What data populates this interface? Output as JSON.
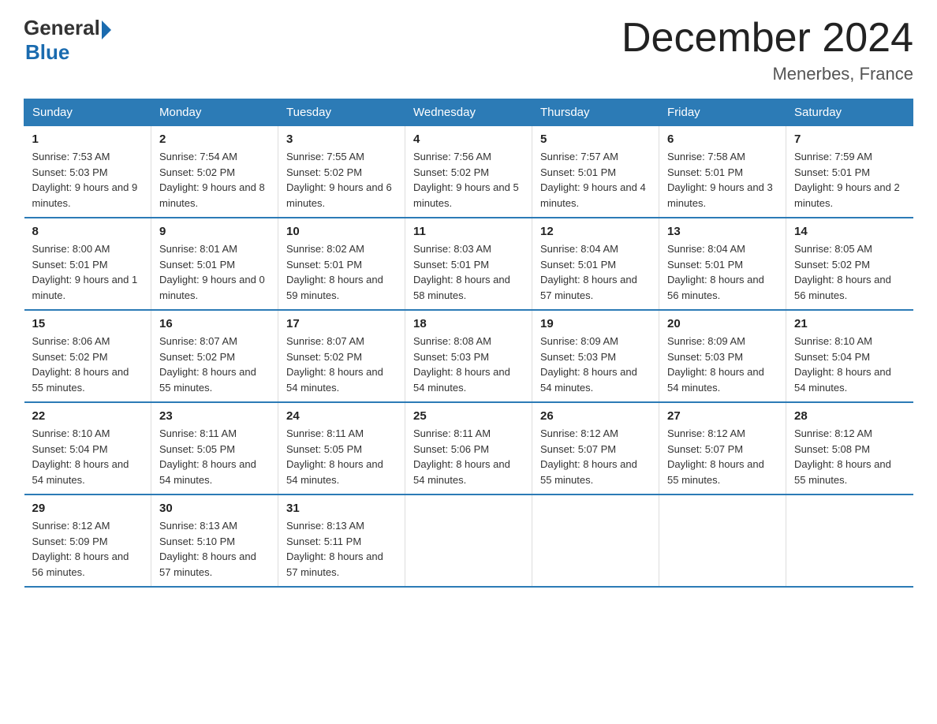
{
  "header": {
    "logo_general": "General",
    "logo_blue": "Blue",
    "title": "December 2024",
    "subtitle": "Menerbes, France"
  },
  "days_of_week": [
    "Sunday",
    "Monday",
    "Tuesday",
    "Wednesday",
    "Thursday",
    "Friday",
    "Saturday"
  ],
  "weeks": [
    [
      {
        "day": "1",
        "sunrise": "7:53 AM",
        "sunset": "5:03 PM",
        "daylight": "9 hours and 9 minutes."
      },
      {
        "day": "2",
        "sunrise": "7:54 AM",
        "sunset": "5:02 PM",
        "daylight": "9 hours and 8 minutes."
      },
      {
        "day": "3",
        "sunrise": "7:55 AM",
        "sunset": "5:02 PM",
        "daylight": "9 hours and 6 minutes."
      },
      {
        "day": "4",
        "sunrise": "7:56 AM",
        "sunset": "5:02 PM",
        "daylight": "9 hours and 5 minutes."
      },
      {
        "day": "5",
        "sunrise": "7:57 AM",
        "sunset": "5:01 PM",
        "daylight": "9 hours and 4 minutes."
      },
      {
        "day": "6",
        "sunrise": "7:58 AM",
        "sunset": "5:01 PM",
        "daylight": "9 hours and 3 minutes."
      },
      {
        "day": "7",
        "sunrise": "7:59 AM",
        "sunset": "5:01 PM",
        "daylight": "9 hours and 2 minutes."
      }
    ],
    [
      {
        "day": "8",
        "sunrise": "8:00 AM",
        "sunset": "5:01 PM",
        "daylight": "9 hours and 1 minute."
      },
      {
        "day": "9",
        "sunrise": "8:01 AM",
        "sunset": "5:01 PM",
        "daylight": "9 hours and 0 minutes."
      },
      {
        "day": "10",
        "sunrise": "8:02 AM",
        "sunset": "5:01 PM",
        "daylight": "8 hours and 59 minutes."
      },
      {
        "day": "11",
        "sunrise": "8:03 AM",
        "sunset": "5:01 PM",
        "daylight": "8 hours and 58 minutes."
      },
      {
        "day": "12",
        "sunrise": "8:04 AM",
        "sunset": "5:01 PM",
        "daylight": "8 hours and 57 minutes."
      },
      {
        "day": "13",
        "sunrise": "8:04 AM",
        "sunset": "5:01 PM",
        "daylight": "8 hours and 56 minutes."
      },
      {
        "day": "14",
        "sunrise": "8:05 AM",
        "sunset": "5:02 PM",
        "daylight": "8 hours and 56 minutes."
      }
    ],
    [
      {
        "day": "15",
        "sunrise": "8:06 AM",
        "sunset": "5:02 PM",
        "daylight": "8 hours and 55 minutes."
      },
      {
        "day": "16",
        "sunrise": "8:07 AM",
        "sunset": "5:02 PM",
        "daylight": "8 hours and 55 minutes."
      },
      {
        "day": "17",
        "sunrise": "8:07 AM",
        "sunset": "5:02 PM",
        "daylight": "8 hours and 54 minutes."
      },
      {
        "day": "18",
        "sunrise": "8:08 AM",
        "sunset": "5:03 PM",
        "daylight": "8 hours and 54 minutes."
      },
      {
        "day": "19",
        "sunrise": "8:09 AM",
        "sunset": "5:03 PM",
        "daylight": "8 hours and 54 minutes."
      },
      {
        "day": "20",
        "sunrise": "8:09 AM",
        "sunset": "5:03 PM",
        "daylight": "8 hours and 54 minutes."
      },
      {
        "day": "21",
        "sunrise": "8:10 AM",
        "sunset": "5:04 PM",
        "daylight": "8 hours and 54 minutes."
      }
    ],
    [
      {
        "day": "22",
        "sunrise": "8:10 AM",
        "sunset": "5:04 PM",
        "daylight": "8 hours and 54 minutes."
      },
      {
        "day": "23",
        "sunrise": "8:11 AM",
        "sunset": "5:05 PM",
        "daylight": "8 hours and 54 minutes."
      },
      {
        "day": "24",
        "sunrise": "8:11 AM",
        "sunset": "5:05 PM",
        "daylight": "8 hours and 54 minutes."
      },
      {
        "day": "25",
        "sunrise": "8:11 AM",
        "sunset": "5:06 PM",
        "daylight": "8 hours and 54 minutes."
      },
      {
        "day": "26",
        "sunrise": "8:12 AM",
        "sunset": "5:07 PM",
        "daylight": "8 hours and 55 minutes."
      },
      {
        "day": "27",
        "sunrise": "8:12 AM",
        "sunset": "5:07 PM",
        "daylight": "8 hours and 55 minutes."
      },
      {
        "day": "28",
        "sunrise": "8:12 AM",
        "sunset": "5:08 PM",
        "daylight": "8 hours and 55 minutes."
      }
    ],
    [
      {
        "day": "29",
        "sunrise": "8:12 AM",
        "sunset": "5:09 PM",
        "daylight": "8 hours and 56 minutes."
      },
      {
        "day": "30",
        "sunrise": "8:13 AM",
        "sunset": "5:10 PM",
        "daylight": "8 hours and 57 minutes."
      },
      {
        "day": "31",
        "sunrise": "8:13 AM",
        "sunset": "5:11 PM",
        "daylight": "8 hours and 57 minutes."
      },
      {
        "day": "",
        "sunrise": "",
        "sunset": "",
        "daylight": ""
      },
      {
        "day": "",
        "sunrise": "",
        "sunset": "",
        "daylight": ""
      },
      {
        "day": "",
        "sunrise": "",
        "sunset": "",
        "daylight": ""
      },
      {
        "day": "",
        "sunrise": "",
        "sunset": "",
        "daylight": ""
      }
    ]
  ]
}
